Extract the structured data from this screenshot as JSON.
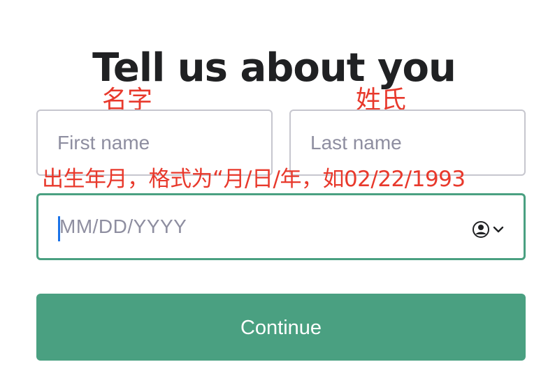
{
  "page": {
    "title": "Tell us about you"
  },
  "annotations": {
    "first_name_note": "名字",
    "last_name_note": "姓氏",
    "birthday_note": "出生年月，格式为“月/日/年，如02/22/1993"
  },
  "form": {
    "first_name": {
      "placeholder": "First name",
      "value": ""
    },
    "last_name": {
      "placeholder": "Last name",
      "value": ""
    },
    "birthday": {
      "placeholder": "MM/DD/YYYY",
      "value": "",
      "autofill_icon": "contact-card-icon",
      "dropdown_icon": "chevron-down-icon"
    },
    "continue_label": "Continue"
  },
  "colors": {
    "accent": "#4aa081",
    "annotation": "#e8392c",
    "placeholder": "#8e8ea0",
    "field_border": "#c6c6ce",
    "caret": "#1a73e8"
  }
}
